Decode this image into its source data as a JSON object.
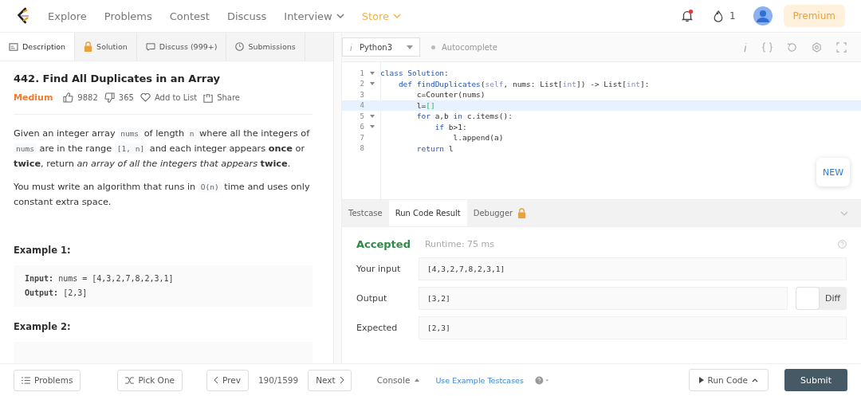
{
  "nav": {
    "items": [
      {
        "label": "Explore",
        "dropdown": false,
        "highlight": false
      },
      {
        "label": "Problems",
        "dropdown": false,
        "highlight": false
      },
      {
        "label": "Contest",
        "dropdown": false,
        "highlight": false
      },
      {
        "label": "Discuss",
        "dropdown": false,
        "highlight": false
      },
      {
        "label": "Interview",
        "dropdown": true,
        "highlight": false
      },
      {
        "label": "Store",
        "dropdown": true,
        "highlight": true
      }
    ],
    "notification_unread": true,
    "streak": "1",
    "premium": "Premium"
  },
  "tabs": [
    {
      "label": "Description",
      "selected": true
    },
    {
      "label": "Solution",
      "selected": false
    },
    {
      "label": "Discuss (999+)",
      "selected": false
    },
    {
      "label": "Submissions",
      "selected": false
    }
  ],
  "language": "Python3",
  "autocomplete": {
    "label": "Autocomplete",
    "on": false
  },
  "problem": {
    "title": "442. Find All Duplicates in an Array",
    "difficulty": "Medium",
    "likes": "9882",
    "dislikes": "365",
    "add_to_list": "Add to List",
    "share": "Share",
    "paragraphs": [
      [
        {
          "kind": "text",
          "text": "Given an integer array "
        },
        {
          "kind": "code",
          "text": "nums"
        },
        {
          "kind": "text",
          "text": " of length "
        },
        {
          "kind": "code",
          "text": "n"
        },
        {
          "kind": "text",
          "text": " where all the integers of "
        },
        {
          "kind": "code",
          "text": "nums"
        },
        {
          "kind": "text",
          "text": " are in the range "
        },
        {
          "kind": "code",
          "text": "[1, n]"
        },
        {
          "kind": "text",
          "text": " and each integer appears **once** or **twice**, return *an array of all the integers that appears* **twice**."
        }
      ],
      [
        {
          "kind": "text",
          "text": "You must write an algorithm that runs in "
        },
        {
          "kind": "code",
          "text": "O(n)"
        },
        {
          "kind": "text",
          "text": " time and uses only constant extra space."
        }
      ]
    ],
    "examples": [
      {
        "title": "Example 1:",
        "lines": [
          {
            "label": "Input:",
            "value": "nums = [4,3,2,7,8,2,3,1]"
          },
          {
            "label": "Output:",
            "value": "[2,3]"
          }
        ]
      },
      {
        "title": "Example 2:"
      }
    ]
  },
  "code": [
    {
      "number": "1",
      "foldable": true,
      "current": false,
      "tokens": [
        {
          "kind": "kw",
          "text": "class"
        },
        {
          "kind": "type",
          "text": " Solution"
        },
        {
          "kind": "plain",
          "text": ":"
        }
      ]
    },
    {
      "number": "2",
      "foldable": true,
      "current": false,
      "tokens": [
        {
          "kind": "kw",
          "text": "    def"
        },
        {
          "kind": "fn",
          "text": " findDuplicates"
        },
        {
          "kind": "plain",
          "text": "("
        },
        {
          "kind": "self",
          "text": "self"
        },
        {
          "kind": "plain",
          "text": ", nums: List["
        },
        {
          "kind": "self",
          "text": "int"
        },
        {
          "kind": "plain",
          "text": "]) -> List["
        },
        {
          "kind": "self",
          "text": "int"
        },
        {
          "kind": "plain",
          "text": "]:"
        }
      ]
    },
    {
      "number": "3",
      "foldable": false,
      "current": false,
      "tokens": [
        {
          "kind": "plain",
          "text": "        c=Counter(nums)"
        }
      ]
    },
    {
      "number": "4",
      "foldable": false,
      "current": true,
      "tokens": [
        {
          "kind": "plain",
          "text": "        l="
        },
        {
          "kind": "bracket",
          "text": "[]"
        }
      ]
    },
    {
      "number": "5",
      "foldable": true,
      "current": false,
      "tokens": [
        {
          "kind": "kw",
          "text": "        for"
        },
        {
          "kind": "plain",
          "text": " a,b "
        },
        {
          "kind": "kw",
          "text": "in"
        },
        {
          "kind": "plain",
          "text": " c.items():"
        }
      ]
    },
    {
      "number": "6",
      "foldable": true,
      "current": false,
      "tokens": [
        {
          "kind": "kw",
          "text": "            if"
        },
        {
          "kind": "plain",
          "text": " b>1:"
        }
      ]
    },
    {
      "number": "7",
      "foldable": false,
      "current": false,
      "tokens": [
        {
          "kind": "plain",
          "text": "                l.append(a)"
        }
      ]
    },
    {
      "number": "8",
      "foldable": false,
      "current": false,
      "tokens": [
        {
          "kind": "kw",
          "text": "        return"
        },
        {
          "kind": "plain",
          "text": " l"
        }
      ]
    }
  ],
  "new_badge": "NEW",
  "result_tabs": [
    {
      "label": "Testcase",
      "locked": false,
      "selected": false
    },
    {
      "label": "Run Code Result",
      "locked": false,
      "selected": true
    },
    {
      "label": "Debugger",
      "locked": true,
      "selected": false
    }
  ],
  "result": {
    "status": "Accepted",
    "runtime": "Runtime: 75 ms",
    "rows": [
      {
        "label": "Your input",
        "value": "[4,3,2,7,8,2,3,1]"
      },
      {
        "label": "Output",
        "value": "[3,2]",
        "diff": {
          "label": "Diff",
          "on": false
        }
      },
      {
        "label": "Expected",
        "value": "[2,3]"
      }
    ]
  },
  "footer": {
    "problems": "Problems",
    "pick_one": "Pick One",
    "prev": "Prev",
    "page": "190/1599",
    "next": "Next",
    "console": "Console",
    "use_example": "Use Example Testcases",
    "run_code": "Run Code",
    "submit": "Submit"
  }
}
